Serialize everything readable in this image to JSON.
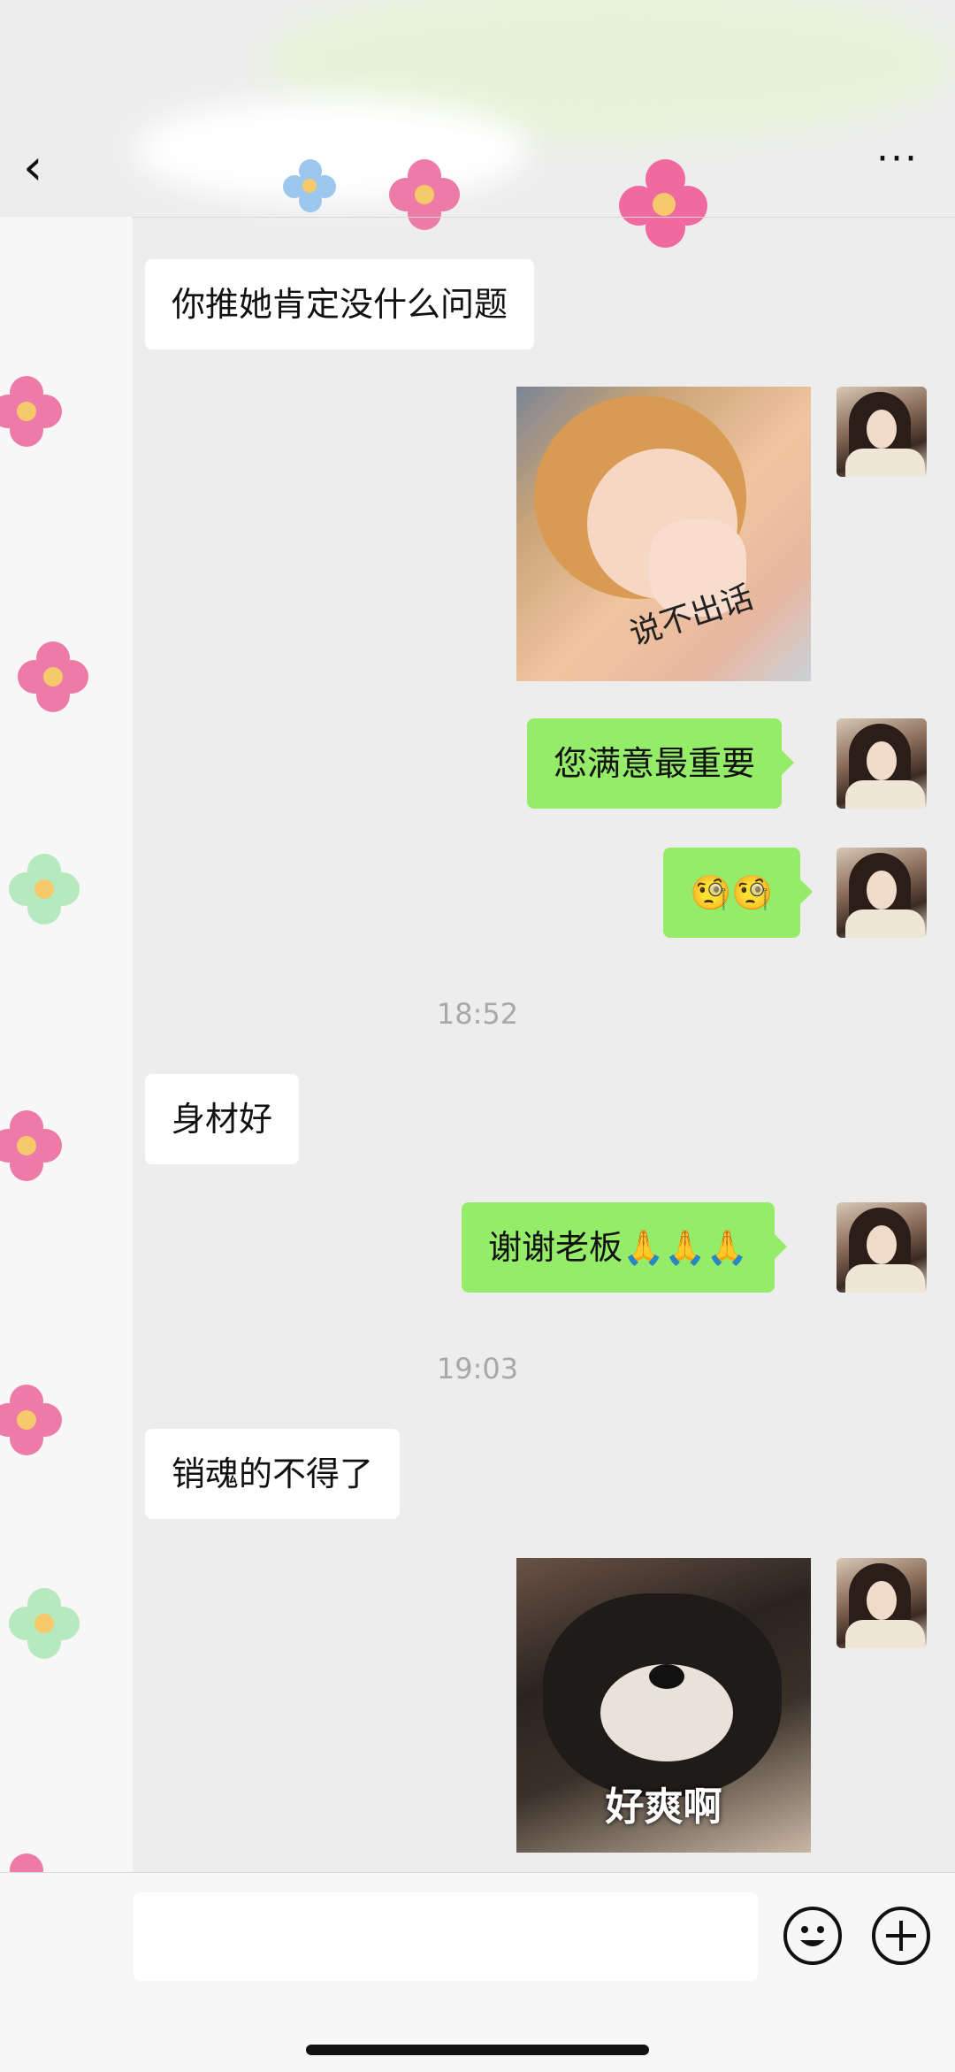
{
  "nav": {
    "back_icon": "‹",
    "more_icon": "···"
  },
  "messages": [
    {
      "side": "left",
      "text": "你推她肯定没什么问题"
    },
    {
      "side": "right",
      "type": "sticker",
      "caption": "说不出话"
    },
    {
      "side": "right",
      "text": "您满意最重要"
    },
    {
      "side": "right",
      "text": "🧐🧐"
    },
    {
      "timestamp": "18:52"
    },
    {
      "side": "left",
      "text": "身材好"
    },
    {
      "side": "right",
      "text": "谢谢老板🙏🙏🙏"
    },
    {
      "timestamp": "19:03"
    },
    {
      "side": "left",
      "text": "销魂的不得了"
    },
    {
      "side": "right",
      "type": "sticker",
      "caption": "好爽啊"
    }
  ],
  "input": {
    "placeholder": ""
  },
  "icons": {
    "emoji": "smiley-icon",
    "add": "plus-icon"
  },
  "colors": {
    "right_bubble": "#95ec69",
    "left_bubble": "#ffffff",
    "background": "#ededed"
  }
}
